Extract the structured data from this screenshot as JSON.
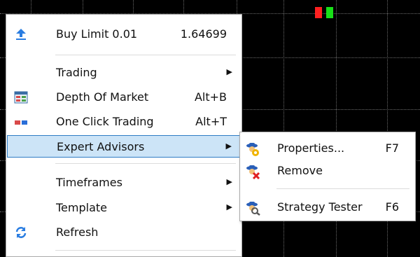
{
  "chart": {
    "background": "#000000",
    "candle_colors": [
      "#ff2020",
      "#18e018"
    ]
  },
  "context_menu": {
    "items": [
      {
        "label": "Buy Limit 0.01",
        "shortcut": "1.64699",
        "icon": "arrow-up-icon"
      },
      {
        "label": "Trading",
        "submenu": true
      },
      {
        "label": "Depth Of Market",
        "shortcut": "Alt+B",
        "icon": "depth-of-market-icon"
      },
      {
        "label": "One Click Trading",
        "shortcut": "Alt+T",
        "icon": "one-click-trading-icon"
      },
      {
        "label": "Expert Advisors",
        "submenu": true,
        "highlighted": true
      },
      {
        "label": "Timeframes",
        "submenu": true
      },
      {
        "label": "Template",
        "submenu": true
      },
      {
        "label": "Refresh",
        "icon": "refresh-icon"
      }
    ],
    "highlight_color": "#cce4f7",
    "highlight_border": "#2f7cc4"
  },
  "expert_advisors_submenu": {
    "items": [
      {
        "label": "Properties...",
        "shortcut": "F7",
        "icon": "expert-properties-icon"
      },
      {
        "label": "Remove",
        "icon": "expert-remove-icon"
      },
      {
        "label": "Strategy Tester",
        "shortcut": "F6",
        "icon": "strategy-tester-icon"
      }
    ]
  }
}
